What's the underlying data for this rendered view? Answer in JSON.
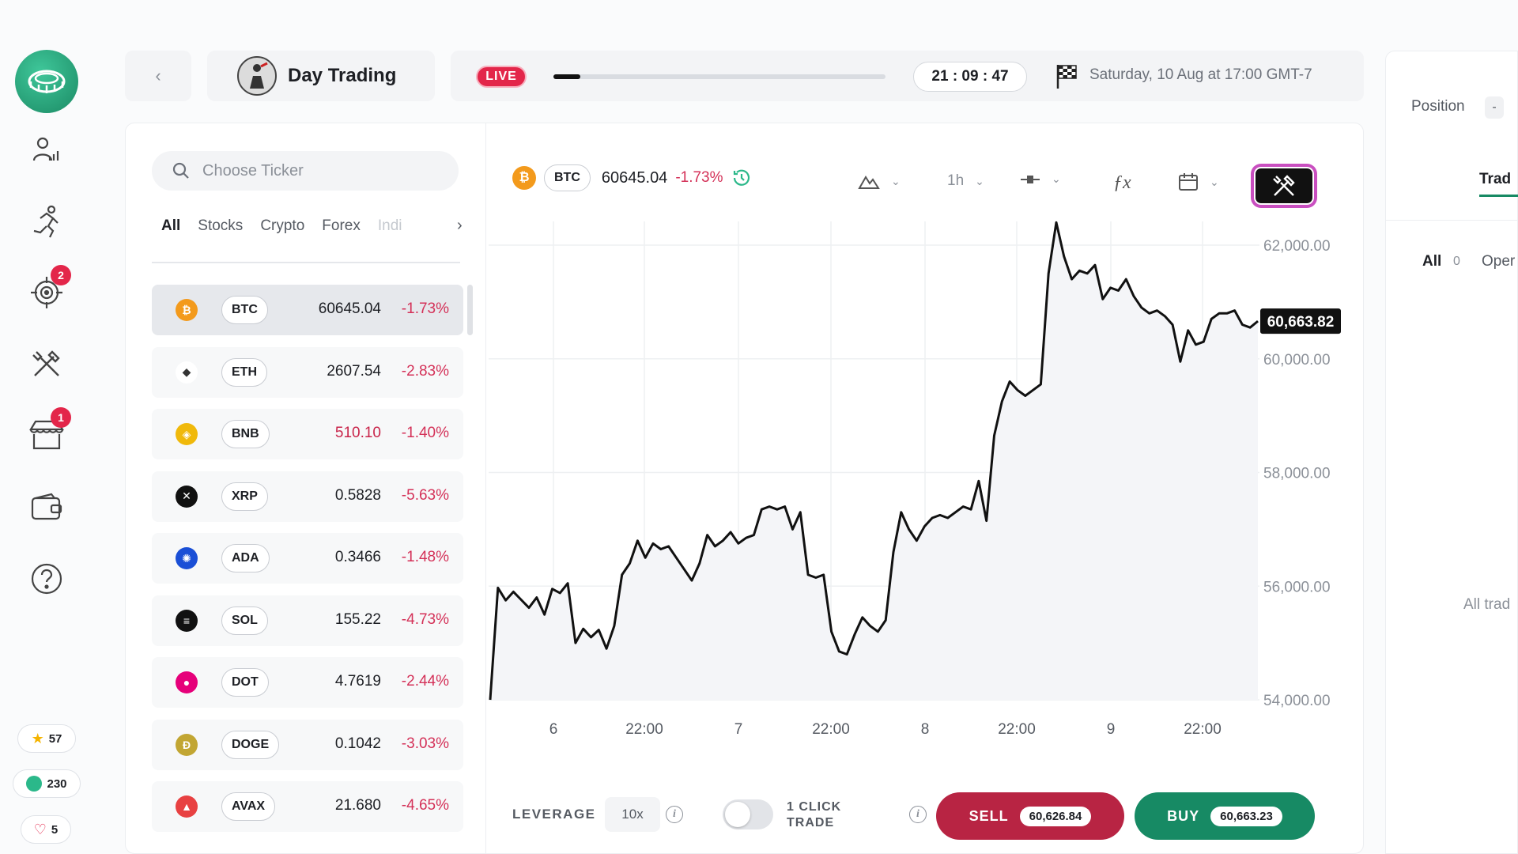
{
  "header": {
    "back_icon": "chevron-left-icon",
    "title": "Day Trading",
    "live_label": "LIVE",
    "progress": 0.08,
    "timer": "21 : 09 : 47",
    "date": "Saturday, 10 Aug at 17:00 GMT-7"
  },
  "sidebar": {
    "badges": {
      "targets": "2",
      "shop": "1"
    },
    "stars": "57",
    "coins": "230",
    "likes": "5"
  },
  "tickers": {
    "search_placeholder": "Choose Ticker",
    "filters": [
      "All",
      "Stocks",
      "Crypto",
      "Forex",
      "Indi"
    ],
    "rows": [
      {
        "symbol": "BTC",
        "price": "60645.04",
        "change": "-1.73%",
        "color": "#f39a1c"
      },
      {
        "symbol": "ETH",
        "price": "2607.54",
        "change": "-2.83%",
        "color": "#ffffff"
      },
      {
        "symbol": "BNB",
        "price": "510.10",
        "change": "-1.40%",
        "color": "#f0b90b"
      },
      {
        "symbol": "XRP",
        "price": "0.5828",
        "change": "-5.63%",
        "color": "#111111"
      },
      {
        "symbol": "ADA",
        "price": "0.3466",
        "change": "-1.48%",
        "color": "#1a4fd6"
      },
      {
        "symbol": "SOL",
        "price": "155.22",
        "change": "-4.73%",
        "color": "#111111"
      },
      {
        "symbol": "DOT",
        "price": "4.7619",
        "change": "-2.44%",
        "color": "#e6007a"
      },
      {
        "symbol": "DOGE",
        "price": "0.1042",
        "change": "-3.03%",
        "color": "#c2a633"
      },
      {
        "symbol": "AVAX",
        "price": "21.680",
        "change": "-4.65%",
        "color": "#e84142"
      }
    ]
  },
  "chart_header": {
    "symbol": "BTC",
    "price": "60645.04",
    "change": "-1.73%",
    "interval": "1h"
  },
  "chart_data": {
    "type": "line",
    "y_ticks": [
      "62,000.00",
      "60,000.00",
      "58,000.00",
      "56,000.00",
      "54,000.00"
    ],
    "x_ticks": [
      "6",
      "22:00",
      "7",
      "22:00",
      "8",
      "22:00",
      "9",
      "22:00"
    ],
    "ylim": [
      54000,
      62000
    ],
    "current_price_label": "60,663.82",
    "series": [
      {
        "values": [
          54000,
          55970,
          55750,
          55900,
          55760,
          55620,
          55800,
          55500,
          55950,
          55880,
          56050,
          55000,
          55250,
          55100,
          55230,
          54900,
          55300,
          56200,
          56400,
          56800,
          56500,
          56750,
          56650,
          56700,
          56500,
          56300,
          56100,
          56400,
          56900,
          56700,
          56800,
          56950,
          56750,
          56850,
          56900,
          57350,
          57400,
          57350,
          57400,
          57000,
          57300,
          56200,
          56150,
          56200,
          55200,
          54850,
          54800,
          55150,
          55450,
          55300,
          55200,
          55400,
          56600,
          57300,
          57000,
          56800,
          57050,
          57200,
          57250,
          57200,
          57300,
          57400,
          57350,
          57850,
          57150,
          58650,
          59250,
          59600,
          59450,
          59350,
          59450,
          59550,
          61500,
          62400,
          61800,
          61400,
          61550,
          61500,
          61650,
          61050,
          61250,
          61200,
          61400,
          61100,
          60900,
          60800,
          60850,
          60750,
          60600,
          59950,
          60500,
          60250,
          60300,
          60700,
          60800,
          60800,
          60850,
          60600,
          60550,
          60663
        ]
      }
    ]
  },
  "trade_bar": {
    "leverage_label": "LEVERAGE",
    "leverage_value": "10x",
    "one_click_label_1": "1 CLICK",
    "one_click_label_2": "TRADE",
    "sell_label": "SELL",
    "sell_price": "60,626.84",
    "buy_label": "BUY",
    "buy_price": "60,663.23"
  },
  "right_panel": {
    "position_label": "Position",
    "position_value": "-",
    "tab": "Trad",
    "all_label": "All",
    "all_count": "0",
    "open_label": "Oper",
    "empty_text": "All trad"
  }
}
